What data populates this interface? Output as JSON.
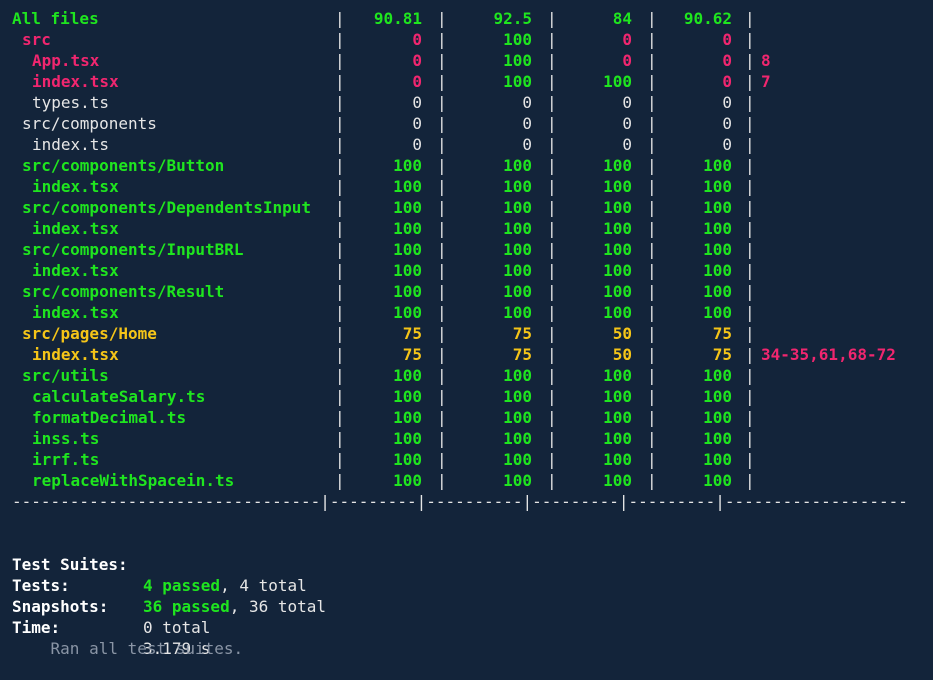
{
  "coverage": {
    "rows": [
      {
        "name": "All files",
        "indent": 0,
        "color": "green",
        "bold": true,
        "stmts": "90.81",
        "branch": "92.5",
        "funcs": "84",
        "lines": "90.62",
        "uncovered": "",
        "cell_colors": [
          "green",
          "green",
          "green",
          "green"
        ]
      },
      {
        "name": "src",
        "indent": 1,
        "color": "red",
        "bold": true,
        "stmts": "0",
        "branch": "100",
        "funcs": "0",
        "lines": "0",
        "uncovered": "",
        "cell_colors": [
          "red",
          "green",
          "red",
          "red"
        ]
      },
      {
        "name": "App.tsx",
        "indent": 2,
        "color": "red",
        "bold": true,
        "stmts": "0",
        "branch": "100",
        "funcs": "0",
        "lines": "0",
        "uncovered": "8",
        "cell_colors": [
          "red",
          "green",
          "red",
          "red"
        ]
      },
      {
        "name": "index.tsx",
        "indent": 2,
        "color": "red",
        "bold": true,
        "stmts": "0",
        "branch": "100",
        "funcs": "100",
        "lines": "0",
        "uncovered": "7",
        "cell_colors": [
          "red",
          "green",
          "green",
          "red"
        ]
      },
      {
        "name": "types.ts",
        "indent": 2,
        "color": "plain",
        "bold": false,
        "stmts": "0",
        "branch": "0",
        "funcs": "0",
        "lines": "0",
        "uncovered": "",
        "cell_colors": [
          "plain",
          "plain",
          "plain",
          "plain"
        ]
      },
      {
        "name": "src/components",
        "indent": 1,
        "color": "plain",
        "bold": false,
        "stmts": "0",
        "branch": "0",
        "funcs": "0",
        "lines": "0",
        "uncovered": "",
        "cell_colors": [
          "plain",
          "plain",
          "plain",
          "plain"
        ]
      },
      {
        "name": "index.ts",
        "indent": 2,
        "color": "plain",
        "bold": false,
        "stmts": "0",
        "branch": "0",
        "funcs": "0",
        "lines": "0",
        "uncovered": "",
        "cell_colors": [
          "plain",
          "plain",
          "plain",
          "plain"
        ]
      },
      {
        "name": "src/components/Button",
        "indent": 1,
        "color": "green",
        "bold": true,
        "stmts": "100",
        "branch": "100",
        "funcs": "100",
        "lines": "100",
        "uncovered": "",
        "cell_colors": [
          "green",
          "green",
          "green",
          "green"
        ]
      },
      {
        "name": "index.tsx",
        "indent": 2,
        "color": "green",
        "bold": true,
        "stmts": "100",
        "branch": "100",
        "funcs": "100",
        "lines": "100",
        "uncovered": "",
        "cell_colors": [
          "green",
          "green",
          "green",
          "green"
        ]
      },
      {
        "name": "src/components/DependentsInput",
        "indent": 1,
        "color": "green",
        "bold": true,
        "stmts": "100",
        "branch": "100",
        "funcs": "100",
        "lines": "100",
        "uncovered": "",
        "cell_colors": [
          "green",
          "green",
          "green",
          "green"
        ]
      },
      {
        "name": "index.tsx",
        "indent": 2,
        "color": "green",
        "bold": true,
        "stmts": "100",
        "branch": "100",
        "funcs": "100",
        "lines": "100",
        "uncovered": "",
        "cell_colors": [
          "green",
          "green",
          "green",
          "green"
        ]
      },
      {
        "name": "src/components/InputBRL",
        "indent": 1,
        "color": "green",
        "bold": true,
        "stmts": "100",
        "branch": "100",
        "funcs": "100",
        "lines": "100",
        "uncovered": "",
        "cell_colors": [
          "green",
          "green",
          "green",
          "green"
        ]
      },
      {
        "name": "index.tsx",
        "indent": 2,
        "color": "green",
        "bold": true,
        "stmts": "100",
        "branch": "100",
        "funcs": "100",
        "lines": "100",
        "uncovered": "",
        "cell_colors": [
          "green",
          "green",
          "green",
          "green"
        ]
      },
      {
        "name": "src/components/Result",
        "indent": 1,
        "color": "green",
        "bold": true,
        "stmts": "100",
        "branch": "100",
        "funcs": "100",
        "lines": "100",
        "uncovered": "",
        "cell_colors": [
          "green",
          "green",
          "green",
          "green"
        ]
      },
      {
        "name": "index.tsx",
        "indent": 2,
        "color": "green",
        "bold": true,
        "stmts": "100",
        "branch": "100",
        "funcs": "100",
        "lines": "100",
        "uncovered": "",
        "cell_colors": [
          "green",
          "green",
          "green",
          "green"
        ]
      },
      {
        "name": "src/pages/Home",
        "indent": 1,
        "color": "yellow",
        "bold": true,
        "stmts": "75",
        "branch": "75",
        "funcs": "50",
        "lines": "75",
        "uncovered": "",
        "cell_colors": [
          "yellow",
          "yellow",
          "yellow",
          "yellow"
        ]
      },
      {
        "name": "index.tsx",
        "indent": 2,
        "color": "yellow",
        "bold": true,
        "stmts": "75",
        "branch": "75",
        "funcs": "50",
        "lines": "75",
        "uncovered": "34-35,61,68-72",
        "cell_colors": [
          "yellow",
          "yellow",
          "yellow",
          "yellow"
        ]
      },
      {
        "name": "src/utils",
        "indent": 1,
        "color": "green",
        "bold": true,
        "stmts": "100",
        "branch": "100",
        "funcs": "100",
        "lines": "100",
        "uncovered": "",
        "cell_colors": [
          "green",
          "green",
          "green",
          "green"
        ]
      },
      {
        "name": "calculateSalary.ts",
        "indent": 2,
        "color": "green",
        "bold": true,
        "stmts": "100",
        "branch": "100",
        "funcs": "100",
        "lines": "100",
        "uncovered": "",
        "cell_colors": [
          "green",
          "green",
          "green",
          "green"
        ]
      },
      {
        "name": "formatDecimal.ts",
        "indent": 2,
        "color": "green",
        "bold": true,
        "stmts": "100",
        "branch": "100",
        "funcs": "100",
        "lines": "100",
        "uncovered": "",
        "cell_colors": [
          "green",
          "green",
          "green",
          "green"
        ]
      },
      {
        "name": "inss.ts",
        "indent": 2,
        "color": "green",
        "bold": true,
        "stmts": "100",
        "branch": "100",
        "funcs": "100",
        "lines": "100",
        "uncovered": "",
        "cell_colors": [
          "green",
          "green",
          "green",
          "green"
        ]
      },
      {
        "name": "irrf.ts",
        "indent": 2,
        "color": "green",
        "bold": true,
        "stmts": "100",
        "branch": "100",
        "funcs": "100",
        "lines": "100",
        "uncovered": "",
        "cell_colors": [
          "green",
          "green",
          "green",
          "green"
        ]
      },
      {
        "name": "replaceWithSpacein.ts",
        "indent": 2,
        "color": "green",
        "bold": true,
        "stmts": "100",
        "branch": "100",
        "funcs": "100",
        "lines": "100",
        "uncovered": "",
        "cell_colors": [
          "green",
          "green",
          "green",
          "green"
        ]
      }
    ],
    "divider": "--------------------------------|---------|----------|---------|---------|-------------------"
  },
  "summary": {
    "suites_label": "Test Suites:",
    "suites_passed": "4 passed",
    "suites_total": ", 4 total",
    "tests_label": "Tests:",
    "tests_passed": "36 passed",
    "tests_total": ", 36 total",
    "snapshots_label": "Snapshots:",
    "snapshots_value": "0 total",
    "time_label": "Time:",
    "time_value": "3.179 s",
    "ran_text": "Ran all test suites."
  },
  "colors": {
    "background": "#13243a",
    "green": "#1fe51f",
    "red": "#f0266f",
    "yellow": "#f5c518",
    "text": "#e6e6e6",
    "muted": "#8a95a5"
  }
}
